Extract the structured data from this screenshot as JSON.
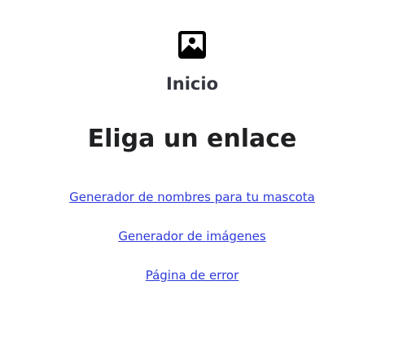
{
  "header": {
    "logo_icon": "image-icon",
    "home_label": "Inicio"
  },
  "main": {
    "heading": "Eliga un enlace",
    "links": [
      {
        "label": "Generador de nombres para tu mascota"
      },
      {
        "label": "Generador de imágenes"
      },
      {
        "label": "Página de error"
      }
    ]
  },
  "colors": {
    "link": "#2f3cd9",
    "text": "#202123",
    "background": "#ffffff"
  }
}
